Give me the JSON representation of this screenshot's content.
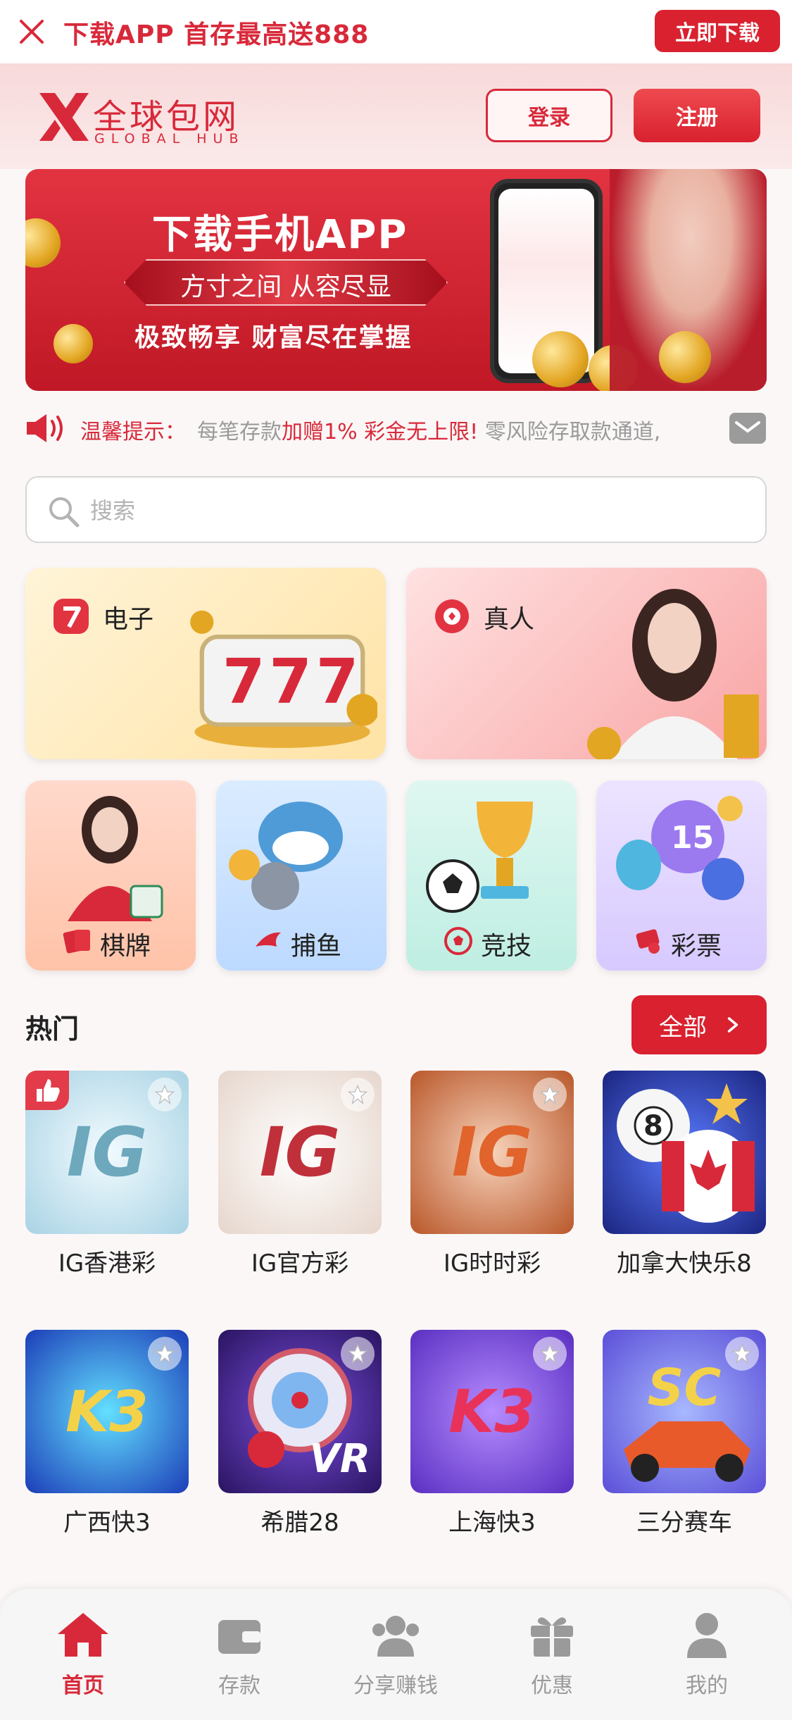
{
  "top_bar": {
    "promo_text": "下载APP 首存最高送888",
    "download_button": "立即下载"
  },
  "header": {
    "logo_cn": "全球包网",
    "logo_en": "GLOBAL HUB",
    "login_button": "登录",
    "register_button": "注册"
  },
  "banner": {
    "title": "下载手机APP",
    "ribbon": "方寸之间 从容尽显",
    "line": "极致畅享 财富尽在掌握"
  },
  "notice": {
    "label": "温馨提示：",
    "text_prefix": "每笔存款",
    "text_highlight": "加赠1% 彩金无上限!",
    "text_suffix": " 零风险存取款通道,"
  },
  "search": {
    "placeholder": "搜索"
  },
  "categories_big": [
    {
      "label": "电子"
    },
    {
      "label": "真人"
    }
  ],
  "categories_small": [
    {
      "label": "棋牌"
    },
    {
      "label": "捕鱼"
    },
    {
      "label": "竞技"
    },
    {
      "label": "彩票"
    }
  ],
  "hot": {
    "title": "热门",
    "all_button": "全部",
    "games": [
      {
        "name": "IG香港彩",
        "tile_text": "IG"
      },
      {
        "name": "IG官方彩",
        "tile_text": "IG"
      },
      {
        "name": "IG时时彩",
        "tile_text": "IG"
      },
      {
        "name": "加拿大快乐8",
        "tile_text": "8"
      },
      {
        "name": "广西快3",
        "tile_text": "K3"
      },
      {
        "name": "希腊28",
        "tile_text": "VR"
      },
      {
        "name": "上海快3",
        "tile_text": "K3"
      },
      {
        "name": "三分赛车",
        "tile_text": "SC"
      }
    ]
  },
  "bottom_nav": [
    {
      "label": "首页",
      "active": true
    },
    {
      "label": "存款",
      "active": false
    },
    {
      "label": "分享赚钱",
      "active": false
    },
    {
      "label": "优惠",
      "active": false
    },
    {
      "label": "我的",
      "active": false
    }
  ],
  "colors": {
    "brand_red": "#d8293a",
    "muted_gray": "#9a9a9a"
  }
}
